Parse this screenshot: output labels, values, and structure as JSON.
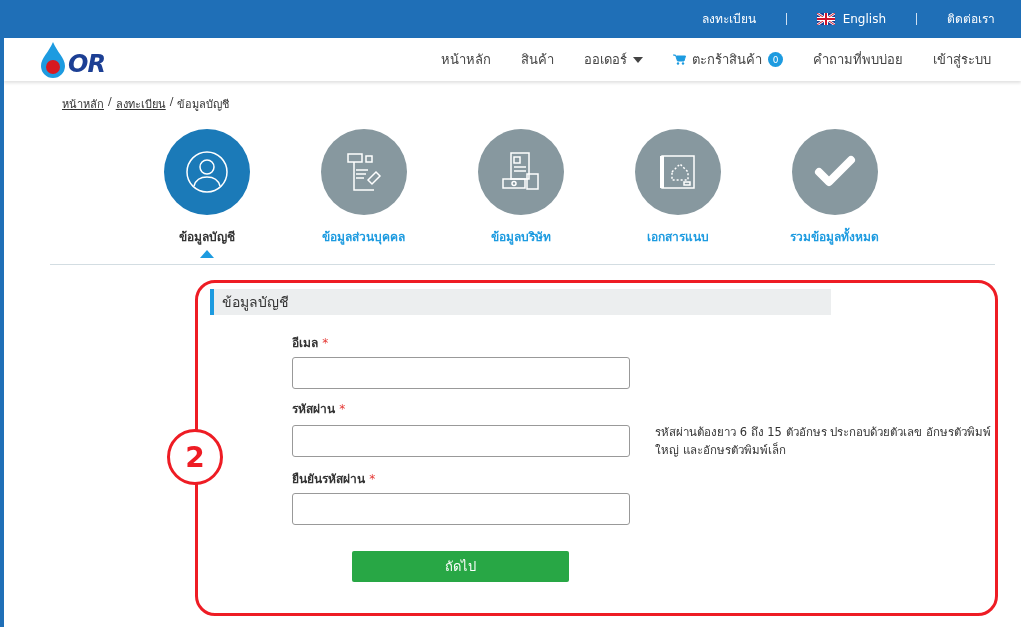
{
  "top_bar": {
    "links": [
      {
        "label": "ลงทะเบียน",
        "kind": "text"
      },
      {
        "label": "English",
        "kind": "language"
      },
      {
        "label": "ติดต่อเรา",
        "kind": "text"
      }
    ]
  },
  "logo": {
    "text": "OR"
  },
  "nav": [
    {
      "label": "หน้าหลัก",
      "kind": "link"
    },
    {
      "label": "สินค้า",
      "kind": "link"
    },
    {
      "label": "ออเดอร์",
      "kind": "dropdown"
    },
    {
      "label": "ตะกร้าสินค้า",
      "kind": "cart",
      "badge": "0"
    },
    {
      "label": "คำถามที่พบบ่อย",
      "kind": "link"
    },
    {
      "label": "เข้าสู่ระบบ",
      "kind": "link"
    }
  ],
  "breadcrumb": {
    "separator": "/",
    "items": [
      {
        "label": "หน้าหลัก",
        "link": true
      },
      {
        "label": "ลงทะเบียน",
        "link": true
      },
      {
        "label": "ข้อมูลบัญชี",
        "link": false
      }
    ]
  },
  "steps": [
    {
      "label": "ข้อมูลบัญชี",
      "kind": "user",
      "selected": true
    },
    {
      "label": "ข้อมูลส่วนบุคคล",
      "kind": "form",
      "selected": false
    },
    {
      "label": "ข้อมูลบริษัท",
      "kind": "company",
      "selected": false
    },
    {
      "label": "เอกสารแนบ",
      "kind": "document",
      "selected": false
    },
    {
      "label": "รวมข้อมูลทั้งหมด",
      "kind": "check",
      "selected": false
    }
  ],
  "annotation": {
    "label": "2"
  },
  "form": {
    "section_title": "ข้อมูลบัญชี",
    "fields": [
      {
        "label": "อีเมล",
        "required_mark": "*"
      },
      {
        "label": "รหัสผ่าน",
        "required_mark": "*",
        "hint": "รหัสผ่านต้องยาว 6 ถึง 15 ตัวอักษร ประกอบด้วยตัวเลข อักษรตัวพิมพ์ใหญ่ และอักษรตัวพิมพ์เล็ก"
      },
      {
        "label": "ยืนยันรหัสผ่าน",
        "required_mark": "*"
      }
    ],
    "submit": "ถัดไป"
  }
}
